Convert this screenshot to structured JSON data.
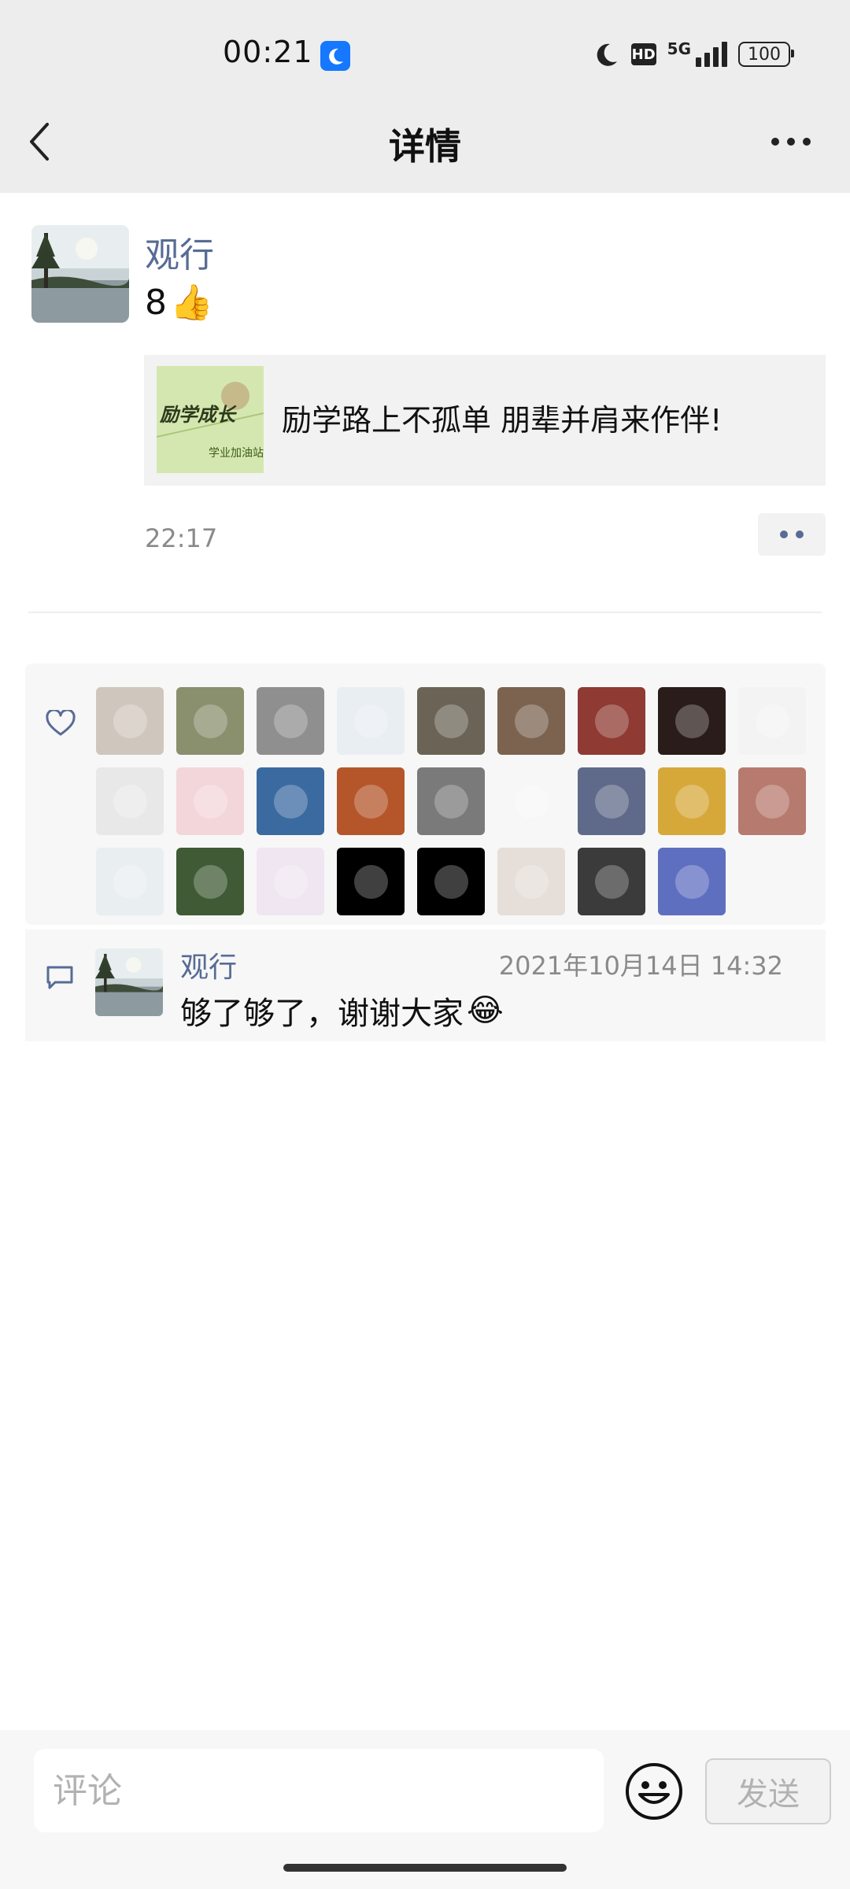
{
  "status_bar": {
    "time": "00:21",
    "network": "5G",
    "hd": "HD",
    "battery": "100",
    "icons": [
      "app-notification-icon",
      "moon-icon",
      "hd-icon",
      "signal-icon",
      "battery-icon"
    ]
  },
  "nav": {
    "title": "详情",
    "back_icon": "chevron-left-icon",
    "more_icon": "more-dots-icon"
  },
  "post": {
    "author": "观行",
    "text": "8",
    "text_emoji": "👍",
    "share_card": {
      "thumb_title": "励学成长",
      "thumb_subtitle": "学业加油站",
      "title": "励学路上不孤单 朋辈并肩来作伴!"
    },
    "time": "22:17"
  },
  "likes": {
    "icon": "heart-icon",
    "count_avatars": 26
  },
  "comments": [
    {
      "author": "观行",
      "date": "2021年10月14日 14:32",
      "text": "够了够了，谢谢大家",
      "emoji": "😂"
    }
  ],
  "composer": {
    "placeholder": "评论",
    "send_label": "发送",
    "emoji_icon": "smiley-icon"
  },
  "colors": {
    "link_blue": "#576b95",
    "header_bg": "#ededed",
    "panel_bg": "#f7f7f7"
  }
}
